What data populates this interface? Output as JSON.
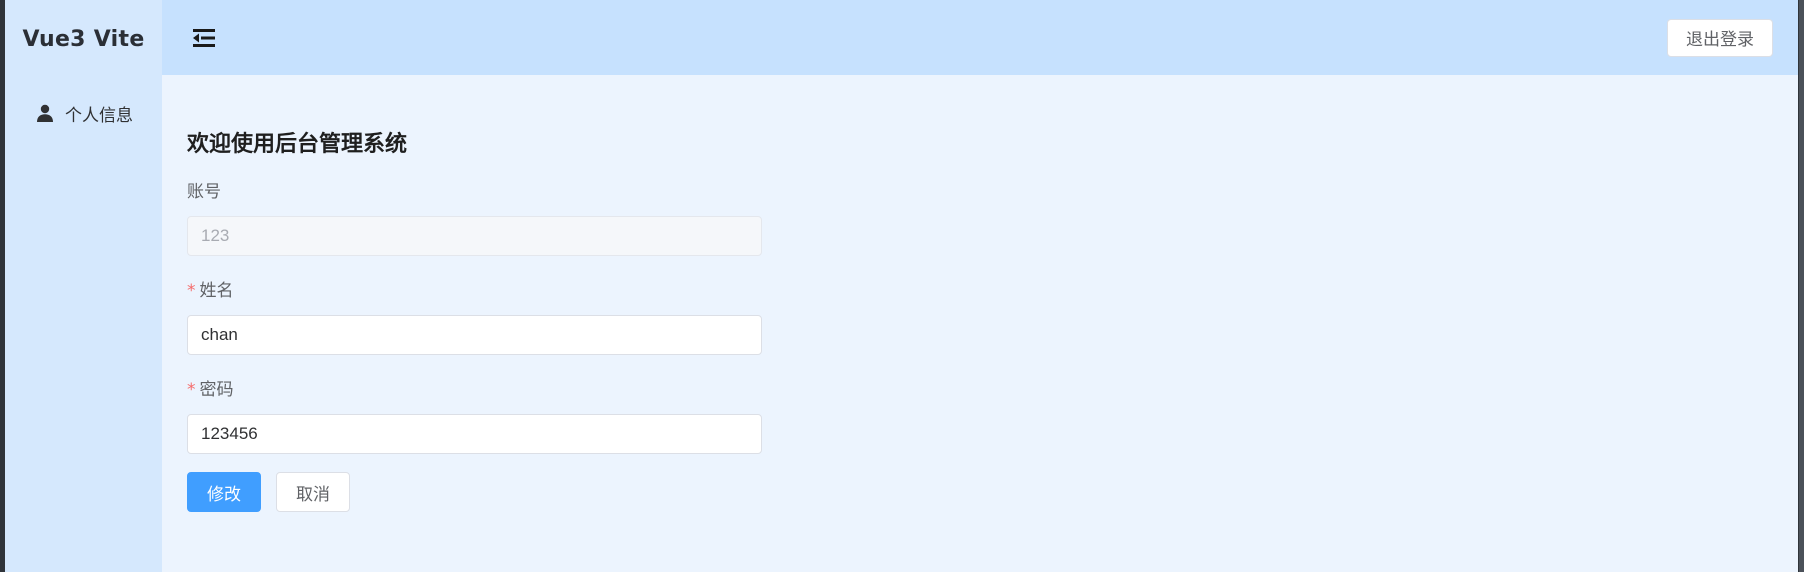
{
  "brand": {
    "title": "Vue3 Vite"
  },
  "sidebar": {
    "items": [
      {
        "label": "个人信息",
        "icon": "user-icon"
      }
    ]
  },
  "header": {
    "collapse_icon": "menu-fold-icon",
    "logout_label": "退出登录"
  },
  "main": {
    "title": "欢迎使用后台管理系统",
    "form": {
      "account": {
        "label": "账号",
        "value": "123",
        "required": false,
        "disabled": true
      },
      "name": {
        "label": "姓名",
        "value": "chan",
        "required": true
      },
      "password": {
        "label": "密码",
        "value": "123456",
        "required": true
      },
      "required_mark": "*",
      "submit_label": "修改",
      "cancel_label": "取消"
    }
  },
  "colors": {
    "sidebar_bg": "#d5e8fd",
    "header_bg": "#c6e1fe",
    "content_bg": "#ecf4fe",
    "primary": "#409eff",
    "required": "#f56c6c"
  }
}
